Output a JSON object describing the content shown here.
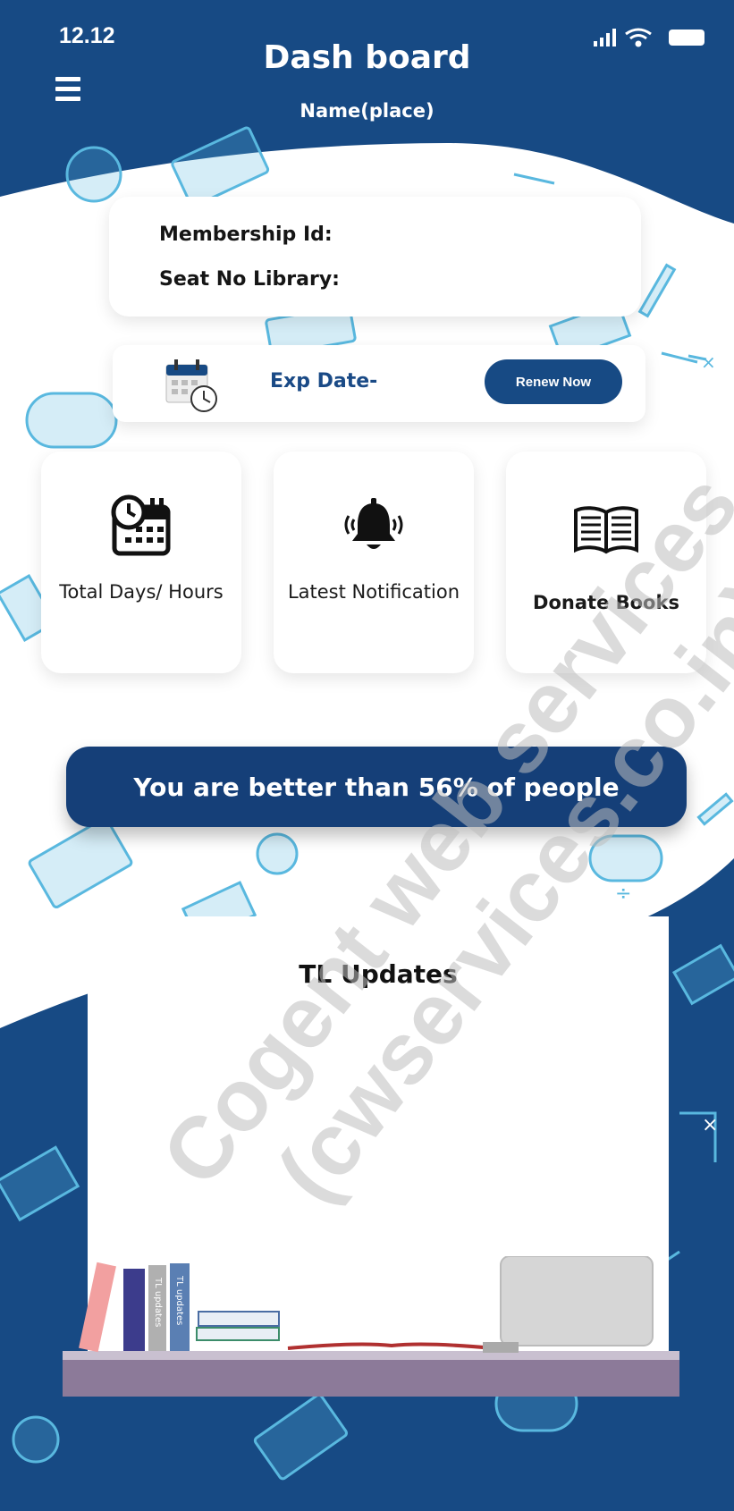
{
  "status_bar": {
    "time": "12.12"
  },
  "header": {
    "title": "Dash board",
    "subtitle": "Name(place)"
  },
  "member_card": {
    "membership_id_label": "Membership Id:",
    "seat_label": "Seat No Library:"
  },
  "expiry": {
    "label": "Exp Date-",
    "renew_button": "Renew Now"
  },
  "tiles": [
    {
      "label": "Total Days/ Hours",
      "icon": "calendar-clock-icon"
    },
    {
      "label": "Latest Notification",
      "icon": "bell-icon"
    },
    {
      "label": "Donate Books",
      "icon": "open-book-icon"
    }
  ],
  "banner": {
    "text": "You are better than 56% of people"
  },
  "updates": {
    "title": "TL Updates",
    "book_spine_label": "TL updates"
  },
  "watermark": {
    "line1": "Cogent web services",
    "line2": "(cwservices.co.in)"
  },
  "colors": {
    "primary": "#174a84",
    "banner": "#153f78",
    "sketch": "#59b8df"
  }
}
